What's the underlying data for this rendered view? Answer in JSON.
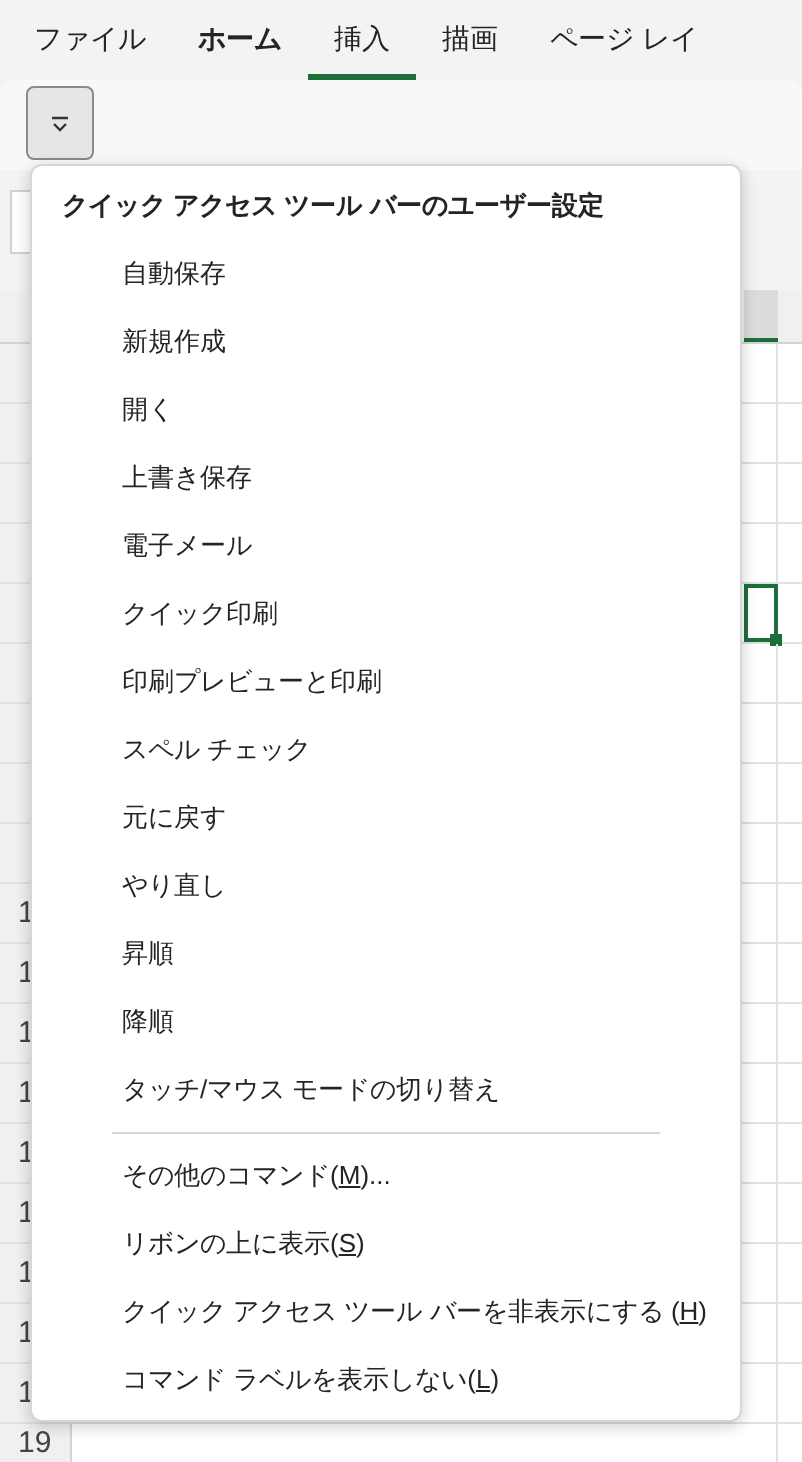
{
  "tabs": [
    {
      "label": "ファイル",
      "selected": false,
      "emphasized": false
    },
    {
      "label": "ホーム",
      "selected": false,
      "emphasized": true
    },
    {
      "label": "挿入",
      "selected": true,
      "emphasized": false
    },
    {
      "label": "描画",
      "selected": false,
      "emphasized": false
    },
    {
      "label": "ページ レイ",
      "selected": false,
      "emphasized": false
    }
  ],
  "row_headers": [
    {
      "text": "1"
    },
    {
      "text": "1"
    },
    {
      "text": "1"
    },
    {
      "text": "1"
    },
    {
      "text": "1"
    },
    {
      "text": "1"
    },
    {
      "text": "1"
    },
    {
      "text": "1"
    },
    {
      "text": "1"
    },
    {
      "text": "19"
    }
  ],
  "menu": {
    "title": "クイック アクセス ツール バーのユーザー設定",
    "items": [
      {
        "label": "自動保存"
      },
      {
        "label": "新規作成"
      },
      {
        "label": "開く"
      },
      {
        "label": "上書き保存"
      },
      {
        "label": "電子メール"
      },
      {
        "label": "クイック印刷"
      },
      {
        "label": "印刷プレビューと印刷"
      },
      {
        "label": "スペル チェック"
      },
      {
        "label": "元に戻す"
      },
      {
        "label": "やり直し"
      },
      {
        "label": "昇順"
      },
      {
        "label": "降順"
      },
      {
        "label": "タッチ/マウス モードの切り替え"
      }
    ],
    "commands": [
      {
        "pre": "その他のコマンド(",
        "key": "M",
        "post": ")..."
      },
      {
        "pre": "リボンの上に表示(",
        "key": "S",
        "post": ")"
      },
      {
        "pre": "クイック アクセス ツール バーを非表示にする (",
        "key": "H",
        "post": ")"
      },
      {
        "pre": "コマンド ラベルを表示しない(",
        "key": "L",
        "post": ")"
      }
    ]
  }
}
